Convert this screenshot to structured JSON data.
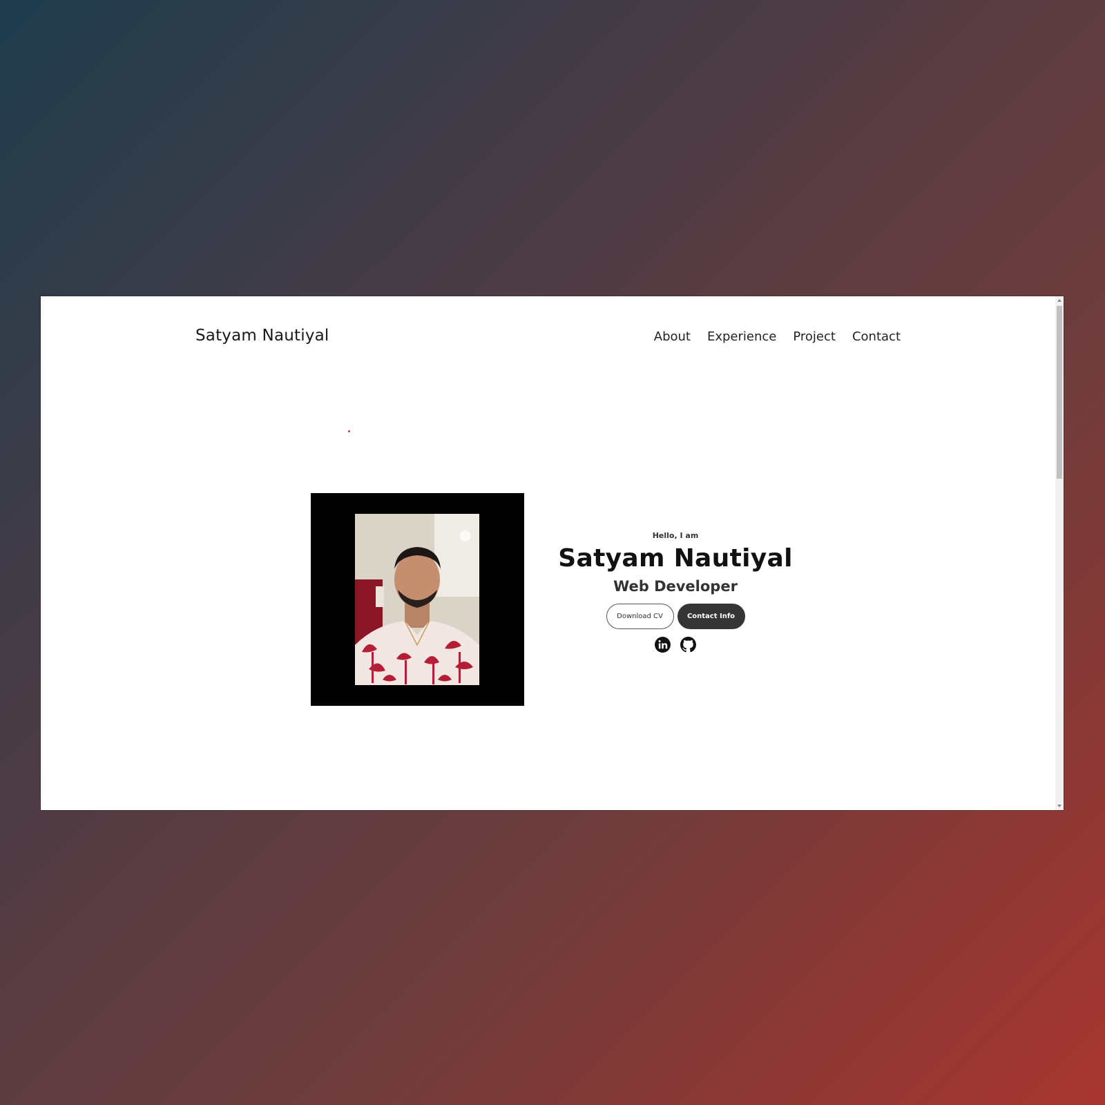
{
  "header": {
    "brand": "Satyam Nautiyal",
    "nav": [
      "About",
      "Experience",
      "Project",
      "Contact"
    ]
  },
  "hero": {
    "greeting": "Hello, I am",
    "name": "Satyam Nautiyal",
    "role": "Web Developer",
    "buttons": {
      "download_cv": "Download CV",
      "contact_info": "Contact Info"
    },
    "socials": [
      "linkedin-icon",
      "github-icon"
    ]
  },
  "colors": {
    "background_gradient": [
      "#1e3c4c",
      "#a8352f"
    ],
    "solid_button": "#353535",
    "photo_frame": "#000000"
  }
}
